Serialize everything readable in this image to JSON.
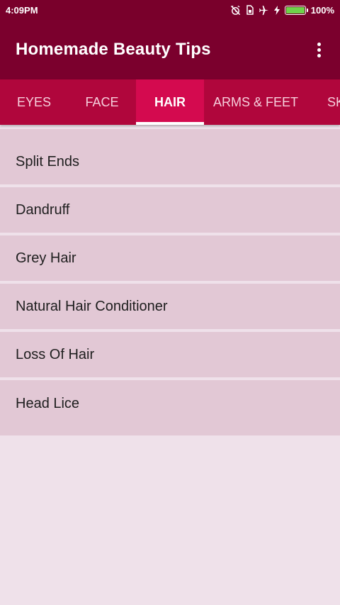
{
  "status_bar": {
    "time": "4:09PM",
    "battery_text": "100%",
    "battery_level": 1.0,
    "icons": [
      "alarm-off-icon",
      "sim-icon",
      "airplane-icon",
      "charging-bolt-icon",
      "battery-icon"
    ]
  },
  "app_bar": {
    "title": "Homemade Beauty Tips",
    "overflow_icon": "more-vert-icon"
  },
  "tabs": [
    {
      "label": "EYES",
      "active": false
    },
    {
      "label": "FACE",
      "active": false
    },
    {
      "label": "HAIR",
      "active": true
    },
    {
      "label": "ARMS & FEET",
      "active": false
    },
    {
      "label": "SK",
      "active": false
    }
  ],
  "list": {
    "items": [
      {
        "label": "Split Ends"
      },
      {
        "label": "Dandruff"
      },
      {
        "label": "Grey Hair"
      },
      {
        "label": "Natural Hair Conditioner"
      },
      {
        "label": "Loss Of Hair"
      },
      {
        "label": "Head Lice"
      }
    ]
  },
  "colors": {
    "status_bar": "#79002b",
    "app_bar": "#7b002d",
    "tab_bar": "#b0063c",
    "active_tab": "#d40a4f",
    "list_item": "#e2c8d5",
    "background": "#efe1ea"
  }
}
